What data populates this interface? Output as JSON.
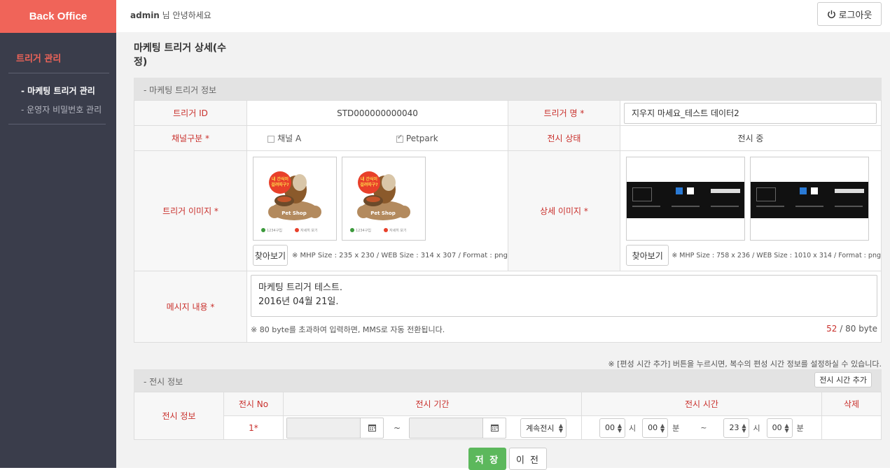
{
  "sidebar": {
    "logo": "Back Office",
    "section_title": "트리거 관리",
    "items": [
      {
        "label": "- 마케팅 트리거 관리"
      },
      {
        "label": "- 운영자 비밀번호 관리"
      }
    ]
  },
  "header": {
    "user": "admin",
    "greeting_suffix": " 님 안녕하세요",
    "logout_label": "로그아웃"
  },
  "page": {
    "title": "마케팅 트리거 상세(수정)"
  },
  "trigger_info": {
    "section_title": "- 마케팅 트리거 정보",
    "id_label": "트리거 ID",
    "id_value": "STD000000000040",
    "name_label": "트리거 명 *",
    "name_value": "지우지 마세요_테스트 데이터2",
    "channel_label": "채널구분 *",
    "channels": [
      {
        "label": "채널 A",
        "checked": false
      },
      {
        "label": "Petpark",
        "checked": true
      }
    ],
    "display_status_label": "전시 상태",
    "display_status_value": "전시 중",
    "trigger_image_label": "트리거 이미지 *",
    "image_promo_text": "내 간식이 걸려따구?",
    "image_shop_text": "Pet Shop",
    "image_footer_1": "1234구입",
    "image_footer_2": "자세히 보기",
    "browse_label": "찾아보기",
    "trigger_image_note": "※ MHP Size : 235 x 230 / WEB Size : 314 x 307 / Format : png",
    "detail_image_label": "상세 이미지 *",
    "detail_image_note": "※ MHP Size : 758 x 236 / WEB Size : 1010 x 314 / Format : png",
    "message_label": "메시지 내용 *",
    "message_line1": "마케팅 트리거 테스트.",
    "message_line2": "2016년 04월 21일.",
    "message_note": "※ 80 byte를 초과하여 입력하면, MMS로 자동 전환됩니다.",
    "byte_count": "52",
    "byte_max": " / 80 byte"
  },
  "display_info": {
    "help_text": "※ [편성 시간 추가] 버튼을 누르시면, 복수의 편성 시간 정보를 설정하실 수 있습니다.",
    "section_title": "- 전시 정보",
    "add_time_label": "전시 시간 추가",
    "row_label": "전시 정보",
    "col_no": "전시 No",
    "col_period": "전시 기간",
    "col_time": "전시 시간",
    "col_delete": "삭제",
    "row_no": "1*",
    "tilde": "~",
    "continuous_option": "계속전시",
    "start_hour": "00",
    "start_minute": "00",
    "end_hour": "23",
    "end_minute": "00",
    "hour_unit": "시",
    "minute_unit": "분"
  },
  "actions": {
    "save_label": "저 장",
    "prev_label": "이 전"
  },
  "colors": {
    "accent": "#f06459",
    "sidebar_bg": "#3a3d4b",
    "label_red": "#c9302c",
    "save_green": "#5cb85c"
  }
}
